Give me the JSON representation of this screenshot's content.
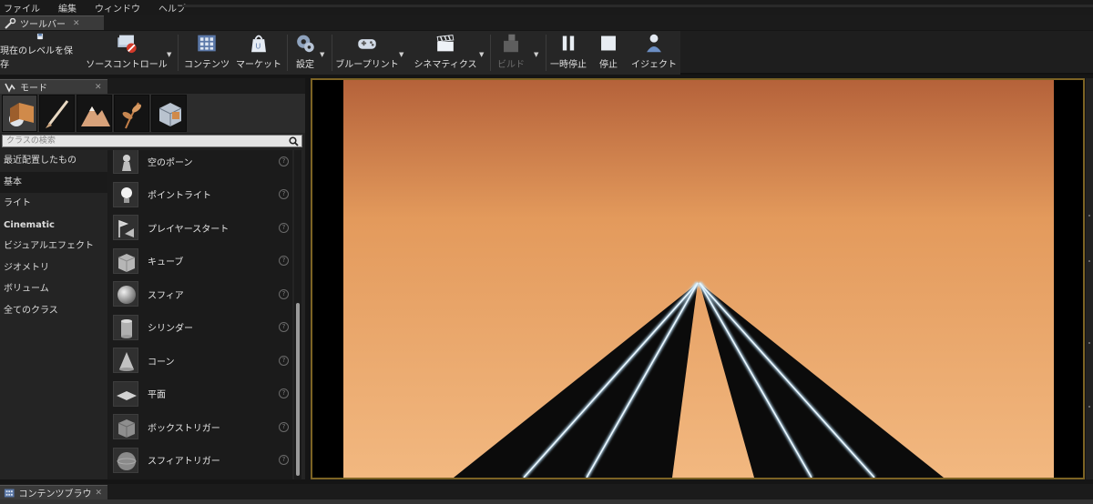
{
  "menu": [
    "ファイル",
    "編集",
    "ウィンドウ",
    "ヘルプ"
  ],
  "toolbar_tab": {
    "label": "ツールバー",
    "icon": "wrench-icon"
  },
  "toolbar": {
    "save_current_level": "現在のレベルを保存",
    "source_control": "ソースコントロール",
    "content": "コンテンツ",
    "marketplace": "マーケット",
    "settings": "設定",
    "blueprints": "ブループリント",
    "cinematics": "シネマティクス",
    "build": "ビルド",
    "pause": "一時停止",
    "stop": "停止",
    "eject": "イジェクト"
  },
  "modes_tab": {
    "label": "モード",
    "icon": "modes-icon"
  },
  "mode_buttons": [
    "place-mode-icon",
    "paint-mode-icon",
    "landscape-mode-icon",
    "foliage-mode-icon",
    "geometry-mode-icon"
  ],
  "search": {
    "placeholder": "クラスの検索"
  },
  "categories": [
    {
      "label": "最近配置したもの",
      "selected": false
    },
    {
      "label": "基本",
      "selected": true
    },
    {
      "label": "ライト",
      "selected": false
    },
    {
      "label": "Cinematic",
      "selected": false
    },
    {
      "label": "ビジュアルエフェクト",
      "selected": false
    },
    {
      "label": "ジオメトリ",
      "selected": false
    },
    {
      "label": "ボリューム",
      "selected": false
    },
    {
      "label": "全てのクラス",
      "selected": false
    }
  ],
  "items": [
    {
      "label": "空のポーン",
      "icon": "pawn-icon"
    },
    {
      "label": "ポイントライト",
      "icon": "light-bulb-icon"
    },
    {
      "label": "プレイヤースタート",
      "icon": "player-start-icon"
    },
    {
      "label": "キューブ",
      "icon": "cube-icon"
    },
    {
      "label": "スフィア",
      "icon": "sphere-icon"
    },
    {
      "label": "シリンダー",
      "icon": "cylinder-icon"
    },
    {
      "label": "コーン",
      "icon": "cone-icon"
    },
    {
      "label": "平面",
      "icon": "plane-icon"
    },
    {
      "label": "ボックストリガー",
      "icon": "box-trigger-icon"
    },
    {
      "label": "スフィアトリガー",
      "icon": "sphere-trigger-icon"
    }
  ],
  "help_glyph": "?",
  "bottom_tab": {
    "label": "コンテンツブラウザ",
    "icon": "content-browser-icon"
  },
  "colors": {
    "sky_top": "#b5623a",
    "sky_mid": "#e39a5c",
    "sky_bottom": "#f2b880",
    "road": "#0b0b0b",
    "road_glow": "#bfe6ff",
    "viewport_border": "#7c6324"
  }
}
